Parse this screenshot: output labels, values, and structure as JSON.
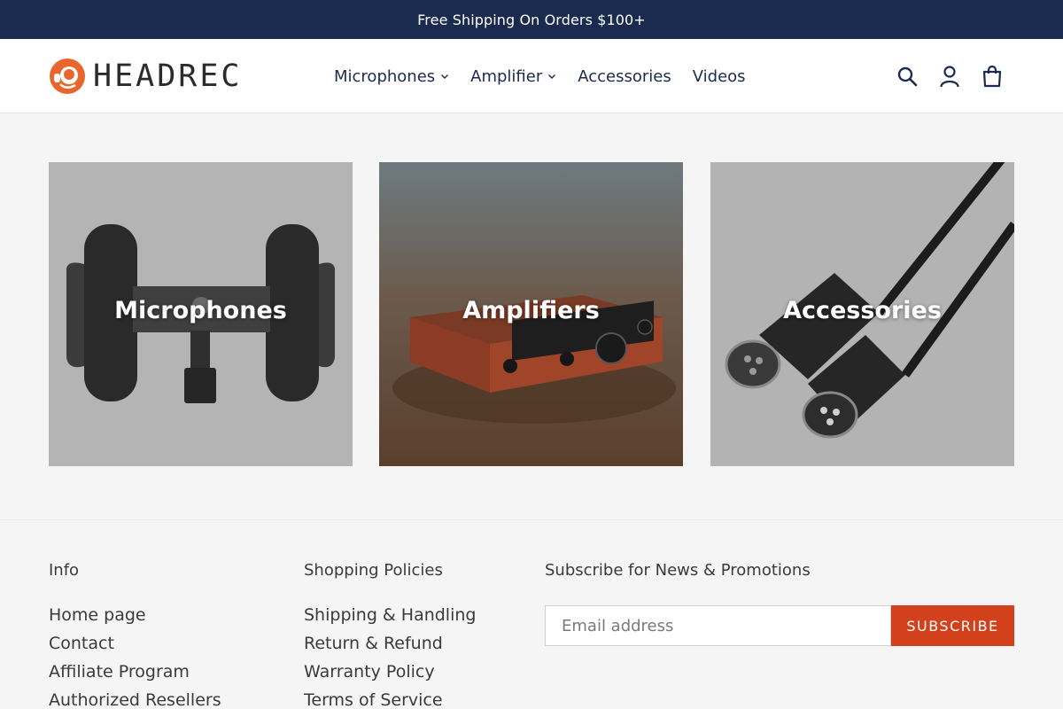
{
  "announcement": {
    "text": "Free Shipping On Orders $100+"
  },
  "brand": {
    "name": "HEADREC",
    "accent": "#e8662d"
  },
  "nav": {
    "items": [
      {
        "label": "Microphones",
        "has_dropdown": true
      },
      {
        "label": "Amplifier",
        "has_dropdown": true
      },
      {
        "label": "Accessories",
        "has_dropdown": false
      },
      {
        "label": "Videos",
        "has_dropdown": false
      }
    ]
  },
  "header_icons": [
    "search-icon",
    "account-icon",
    "cart-icon"
  ],
  "collections": [
    {
      "title": "Microphones"
    },
    {
      "title": "Amplifiers"
    },
    {
      "title": "Accessories"
    }
  ],
  "footer": {
    "info": {
      "heading": "Info",
      "links": [
        "Home page",
        "Contact",
        "Affiliate Program",
        "Authorized Resellers"
      ]
    },
    "policies": {
      "heading": "Shopping Policies",
      "links": [
        "Shipping & Handling",
        "Return & Refund",
        "Warranty Policy",
        "Terms of Service"
      ]
    },
    "newsletter": {
      "heading": "Subscribe for News & Promotions",
      "placeholder": "Email address",
      "button_label": "SUBSCRIBE"
    }
  },
  "colors": {
    "announcement_bg": "#1a2b4f",
    "nav_text": "#1a2b4f",
    "subscribe_button": "#d3401c",
    "page_bg": "#f5f5f5"
  }
}
